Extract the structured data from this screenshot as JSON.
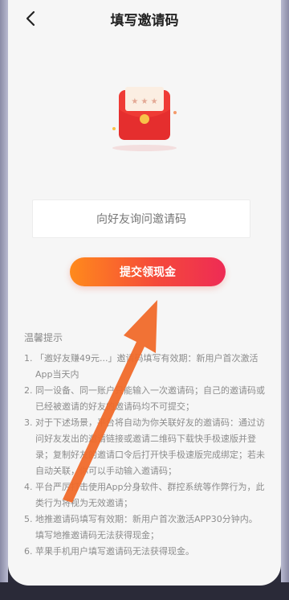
{
  "header": {
    "title": "填写邀请码"
  },
  "input": {
    "placeholder": "向好友询问邀请码"
  },
  "submit": {
    "label": "提交领现金"
  },
  "tips": {
    "title": "温馨提示",
    "items": [
      {
        "num": "1.",
        "text": "「邀好友赚49元...」邀请码填写有效期：新用户首次激活App当天内"
      },
      {
        "num": "2.",
        "text": "同一设备、同一账户只能输入一次邀请码；自己的邀请码或已经被邀请的好友的邀请码均不可提交；"
      },
      {
        "num": "3.",
        "text": "对于下述场景，平台将自动为你关联好友的邀请码：通过访问好友发出的邀请链接或邀请二维码下载快手极速版并登录；复制好友的邀请口令后打开快手极速版完成绑定；若未自动关联，你可以手动输入邀请码；"
      },
      {
        "num": "4.",
        "text": "平台严厉打击使用App分身软件、群控系统等作弊行为，此类行为将视为无效邀请；"
      },
      {
        "num": "5.",
        "text": "地推邀请码填写有效期：新用户首次激活APP30分钟内。填写地推邀请码无法获得现金；"
      },
      {
        "num": "6.",
        "text": "苹果手机用户填写邀请码无法获得现金。"
      }
    ]
  },
  "colors": {
    "accent_start": "#ff8a1c",
    "accent_end": "#ee2b55",
    "envelope": "#ef3b35",
    "arrow": "#f06a2a"
  }
}
